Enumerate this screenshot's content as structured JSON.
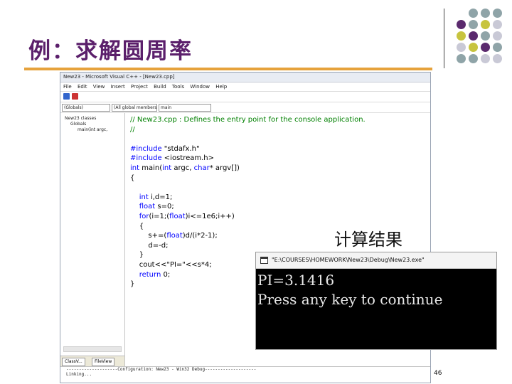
{
  "slide": {
    "title": "例：求解圆周率",
    "result_label": "计算结果",
    "page_number": "46",
    "accent_color": "#e6a23c",
    "title_color": "#5b1f6b"
  },
  "ide": {
    "window_title": "New23 - Microsoft Visual C++ - [New23.cpp]",
    "menu": [
      "File",
      "Edit",
      "View",
      "Insert",
      "Project",
      "Build",
      "Tools",
      "Window",
      "Help"
    ],
    "combos": {
      "scope": "(Globals)",
      "members": "(All global members)",
      "function": "main"
    },
    "tree": [
      "New23 classes",
      "Globals",
      "main(int argc,"
    ],
    "workspace_tabs": [
      "ClassV...",
      "FileView"
    ],
    "code_lines": [
      "// New23.cpp : Defines the entry point for the console application.",
      "//",
      "",
      "#include \"stdafx.h\"",
      "#include <iostream.h>",
      "int main(int argc, char* argv[])",
      "{",
      "",
      "    int i,d=1;",
      "    float s=0;",
      "    for(i=1;(float)i<=1e6;i++)",
      "    {",
      "        s+=(float)d/(i*2-1);",
      "        d=-d;",
      "    }",
      "    cout<<\"PI=\"<<s*4;",
      "    return 0;",
      "}"
    ],
    "build_output": [
      "--------------------Configuration: New23 - Win32 Debug--------------------",
      "Linking..."
    ]
  },
  "console": {
    "title": "\"E:\\COURSES\\HOMEWORK\\New23\\Debug\\New23.exe\"",
    "output": [
      "PI=3.1416",
      "Press any key to continue"
    ]
  },
  "decor": {
    "dot_colors": [
      "#5b2a6e",
      "#8fa4a8",
      "#c7c43f",
      "#c9c9d6"
    ]
  }
}
